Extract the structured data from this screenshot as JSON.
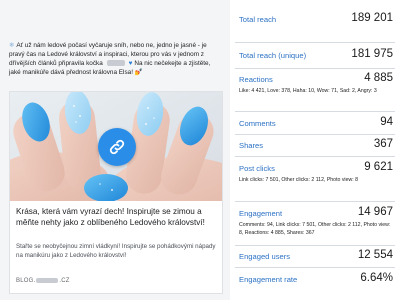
{
  "post": {
    "text_part1": "Ať už nám ledové počasí vyčaruje sníh, nebo ne, jedno je jasné - je pravý čas na Ledové království a inspiraci, kterou pro vás v jednom z dřívějších článků připravila kočka",
    "text_part2": "Na nic nečekejte a zjistěte, jaké manikúře dává přednost královna Elsa!",
    "emoji_end": "💅",
    "link_card": {
      "title": "Krása, která vám vyrazí dech! Inspirujte se zimou a měňte nehty jako z oblíbeného Ledového království!",
      "description": "Stařte se neobyčejnou zimní vládkyní! Inspirujte se pohádkovými nápady na manikúru jako z Ledového království!",
      "domain_prefix": "BLOG.",
      "domain_suffix": ".CZ"
    }
  },
  "metrics": [
    {
      "label": "Total reach",
      "value": "189 201"
    },
    {
      "label": "Total reach (unique)",
      "value": "181 975"
    },
    {
      "label": "Reactions",
      "value": "4 885",
      "detail": "Like: 4 421, Love: 378, Haha: 10, Wow: 71, Sad: 2, Angry: 3"
    },
    {
      "label": "Comments",
      "value": "94"
    },
    {
      "label": "Shares",
      "value": "367"
    },
    {
      "label": "Post clicks",
      "value": "9 621",
      "detail": "Link clicks: 7 501, Other clicks: 2 112, Photo view: 8"
    },
    {
      "label": "Engagement",
      "value": "14 967",
      "detail": "Comments: 94, Link clicks: 7 501, Other clicks: 2 112, Photo view: 8, Reactions: 4 885, Shares: 367"
    },
    {
      "label": "Engaged users",
      "value": "12 554"
    },
    {
      "label": "Engagement rate",
      "value": "6.64%"
    }
  ],
  "colors": {
    "metric_label": "#2d72c4",
    "link_badge": "#2a8ee8",
    "nail_blue": "#3aa6e8"
  },
  "icons": {
    "post_start": "snowflake-icon",
    "inline": "blue-heart-icon",
    "badge": "link-icon"
  }
}
